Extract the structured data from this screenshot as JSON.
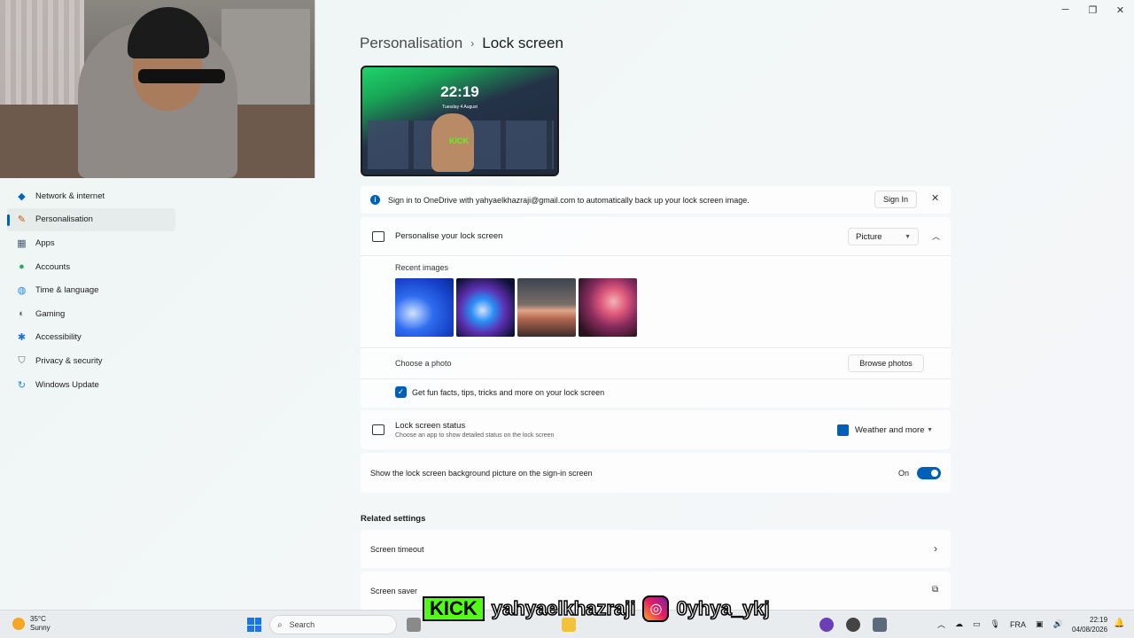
{
  "window": {
    "controls": [
      "─",
      "❐",
      "✕"
    ]
  },
  "breadcrumb": {
    "parent": "Personalisation",
    "separator": "›",
    "current": "Lock screen"
  },
  "preview": {
    "time": "22:19",
    "date": "Tuesday 4 August",
    "kick": "KICK"
  },
  "sidebar": {
    "items": [
      {
        "label": "Network & internet",
        "icon": "wifi-icon",
        "color": "#0067c0",
        "active": false
      },
      {
        "label": "Personalisation",
        "icon": "brush-icon",
        "color": "#c2571a",
        "active": true
      },
      {
        "label": "Apps",
        "icon": "apps-icon",
        "color": "#4a5a70",
        "active": false
      },
      {
        "label": "Accounts",
        "icon": "person-icon",
        "color": "#2ea865",
        "active": false
      },
      {
        "label": "Time & language",
        "icon": "globe-icon",
        "color": "#1e88e5",
        "active": false
      },
      {
        "label": "Gaming",
        "icon": "gamepad-icon",
        "color": "#6b6b6b",
        "active": false
      },
      {
        "label": "Accessibility",
        "icon": "accessibility-icon",
        "color": "#1e6fd1",
        "active": false
      },
      {
        "label": "Privacy & security",
        "icon": "shield-icon",
        "color": "#6b6b6b",
        "active": false
      },
      {
        "label": "Windows Update",
        "icon": "update-icon",
        "color": "#1e88e5",
        "active": false
      }
    ]
  },
  "banner": {
    "text": "Sign in to OneDrive with yahyaelkhazraji@gmail.com to automatically back up your lock screen image.",
    "button": "Sign In"
  },
  "personalise": {
    "title": "Personalise your lock screen",
    "selected": "Picture",
    "recent_label": "Recent images",
    "choose_label": "Choose a photo",
    "browse_button": "Browse photos",
    "facts_label": "Get fun facts, tips, tricks and more on your lock screen",
    "facts_checked": true
  },
  "status": {
    "title": "Lock screen status",
    "subtitle": "Choose an app to show detailed status on the lock screen",
    "selected": "Weather and more"
  },
  "signin_bg": {
    "label": "Show the lock screen background picture on the sign-in screen",
    "state": "On"
  },
  "related": {
    "heading": "Related settings",
    "items": [
      "Screen timeout",
      "Screen saver"
    ]
  },
  "overlay": {
    "kick": "KICK",
    "kick_handle": "yahyaelkhazraji",
    "ig_handle": "0yhya_ykj"
  },
  "taskbar": {
    "temperature": "35°C",
    "condition": "Sunny",
    "search_placeholder": "Search",
    "lang": "FRA",
    "time": "22:19",
    "date": "04/08/2026"
  },
  "colors": {
    "accent": "#005fb8",
    "kick_green": "#53fc18"
  }
}
